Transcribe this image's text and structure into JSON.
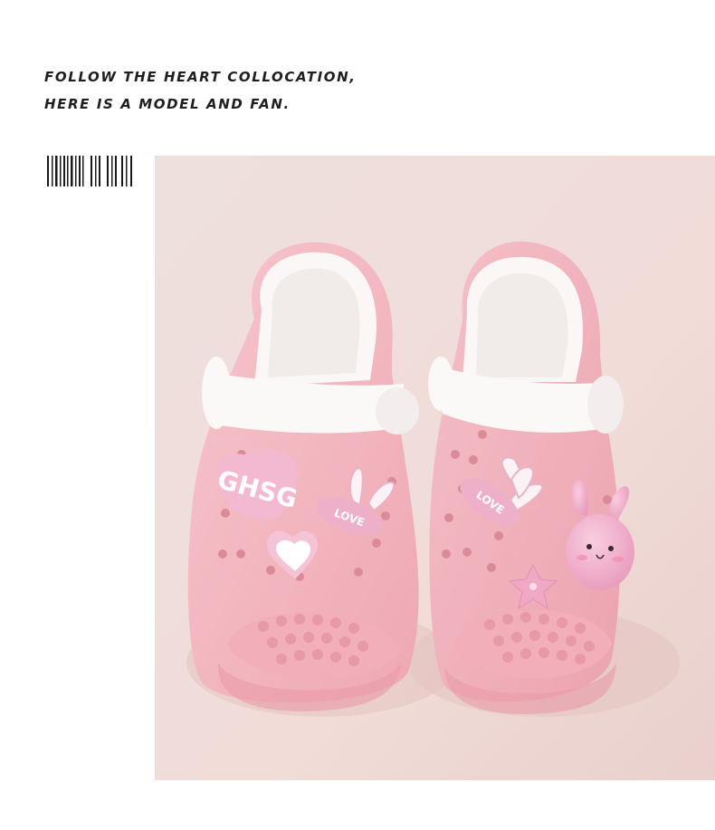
{
  "headline": {
    "line1": "FOLLOW THE HEART COLLOCATION,",
    "line2": "HERE IS A MODEL AND FAN."
  },
  "photo": {
    "charm_brand_text": "GHSG",
    "charm_love_text": "LOVE",
    "colors": {
      "background": "#f2dcd9",
      "shoe_pink": "#f4b8c0",
      "strap_white": "#fbf8f8",
      "charm_pink": "#f3b3cd"
    }
  },
  "barcode_icon": "barcode-icon"
}
